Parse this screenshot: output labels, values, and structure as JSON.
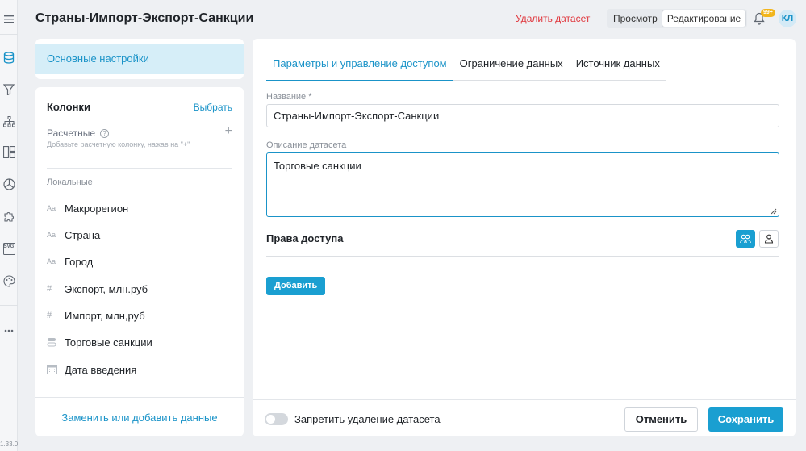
{
  "header": {
    "title": "Страны-Импорт-Экспорт-Санкции",
    "delete_link": "Удалить датасет",
    "modes": [
      "Просмотр",
      "Редактирование"
    ],
    "active_mode": "Редактирование",
    "notifications_badge": "99+",
    "avatar_initials": "КЛ"
  },
  "rail": {
    "icons": [
      "menu-icon",
      "database-icon",
      "filter-icon",
      "hierarchy-icon",
      "layout-icon",
      "pie-chart-icon",
      "puzzle-icon",
      "svg-icon",
      "palette-icon",
      "more-icon"
    ],
    "svg_label": "SVG",
    "version": "1.33.0"
  },
  "left_nav": {
    "selected": "Основные настройки"
  },
  "columns": {
    "title": "Колонки",
    "pick_link": "Выбрать",
    "calc_label": "Расчетные",
    "calc_help": "?",
    "calc_add": "+",
    "calc_hint": "Добавьте расчетную колонку, нажав на \"+\"",
    "local_label": "Локальные",
    "items": [
      {
        "type": "Aa",
        "label": "Макрорегион"
      },
      {
        "type": "Aa",
        "label": "Страна"
      },
      {
        "type": "Aa",
        "label": "Город"
      },
      {
        "type": "#",
        "label": "Экспорт, млн.руб"
      },
      {
        "type": "#",
        "label": "Импорт, млн,руб"
      },
      {
        "type": "toggle",
        "label": "Торговые санкции"
      },
      {
        "type": "calendar",
        "label": "Дата введения"
      }
    ],
    "replace_link": "Заменить или добавить данные"
  },
  "main": {
    "tabs": [
      "Параметры и управление доступом",
      "Ограничение данных",
      "Источник данных"
    ],
    "active_tab": 0,
    "name_label": "Название *",
    "name_value": "Страны-Импорт-Экспорт-Санкции",
    "desc_label": "Описание датасета",
    "desc_value": "Торговые санкции",
    "rights_title": "Права доступа",
    "add_button": "Добавить",
    "forbid_delete_label": "Запретить удаление датасета",
    "forbid_delete_on": false,
    "cancel_button": "Отменить",
    "save_button": "Сохранить"
  },
  "colors": {
    "accent": "#1a9fd1",
    "danger": "#e0383e",
    "badge": "#f2b51c"
  }
}
